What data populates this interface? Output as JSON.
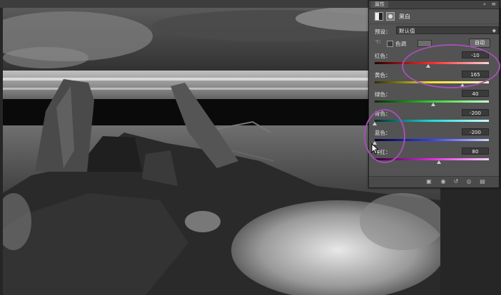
{
  "panel": {
    "tab_label": "属性",
    "collapse_glyph": "»",
    "menu_glyph": "≡",
    "title": "黑白",
    "preset_label": "预设：",
    "preset_value": "默认值",
    "tint_label": "色调",
    "auto_label": "自动",
    "sliders": [
      {
        "label": "红色：",
        "value": "-10",
        "fraction": 0.47,
        "gradient": "linear-gradient(90deg,#2e0000,#ff2a2a,#ffd0d0)"
      },
      {
        "label": "黄色：",
        "value": "165",
        "fraction": 0.77,
        "gradient": "linear-gradient(90deg,#2e2e00,#f2e12a,#fff7c4)"
      },
      {
        "label": "绿色：",
        "value": "40",
        "fraction": 0.51,
        "gradient": "linear-gradient(90deg,#002e00,#2ed02e,#c8ffd0)"
      },
      {
        "label": "青色：",
        "value": "-200",
        "fraction": 0.0,
        "gradient": "linear-gradient(90deg,#002e2e,#20d8d8,#c8ffff)"
      },
      {
        "label": "蓝色：",
        "value": "-200",
        "fraction": 0.0,
        "gradient": "linear-gradient(90deg,#00002e,#3040ff,#d0d4ff)"
      },
      {
        "label": "洋红：",
        "value": "80",
        "fraction": 0.56,
        "gradient": "linear-gradient(90deg,#2e002e,#e02ae0,#ffd0ff)"
      }
    ],
    "footer_icons": [
      "clip-to-layer-icon",
      "view-previous-icon",
      "reset-icon",
      "visibility-icon",
      "delete-icon"
    ]
  },
  "colors": {
    "panel_bg": "#535353",
    "annotation": "#a350b3"
  }
}
